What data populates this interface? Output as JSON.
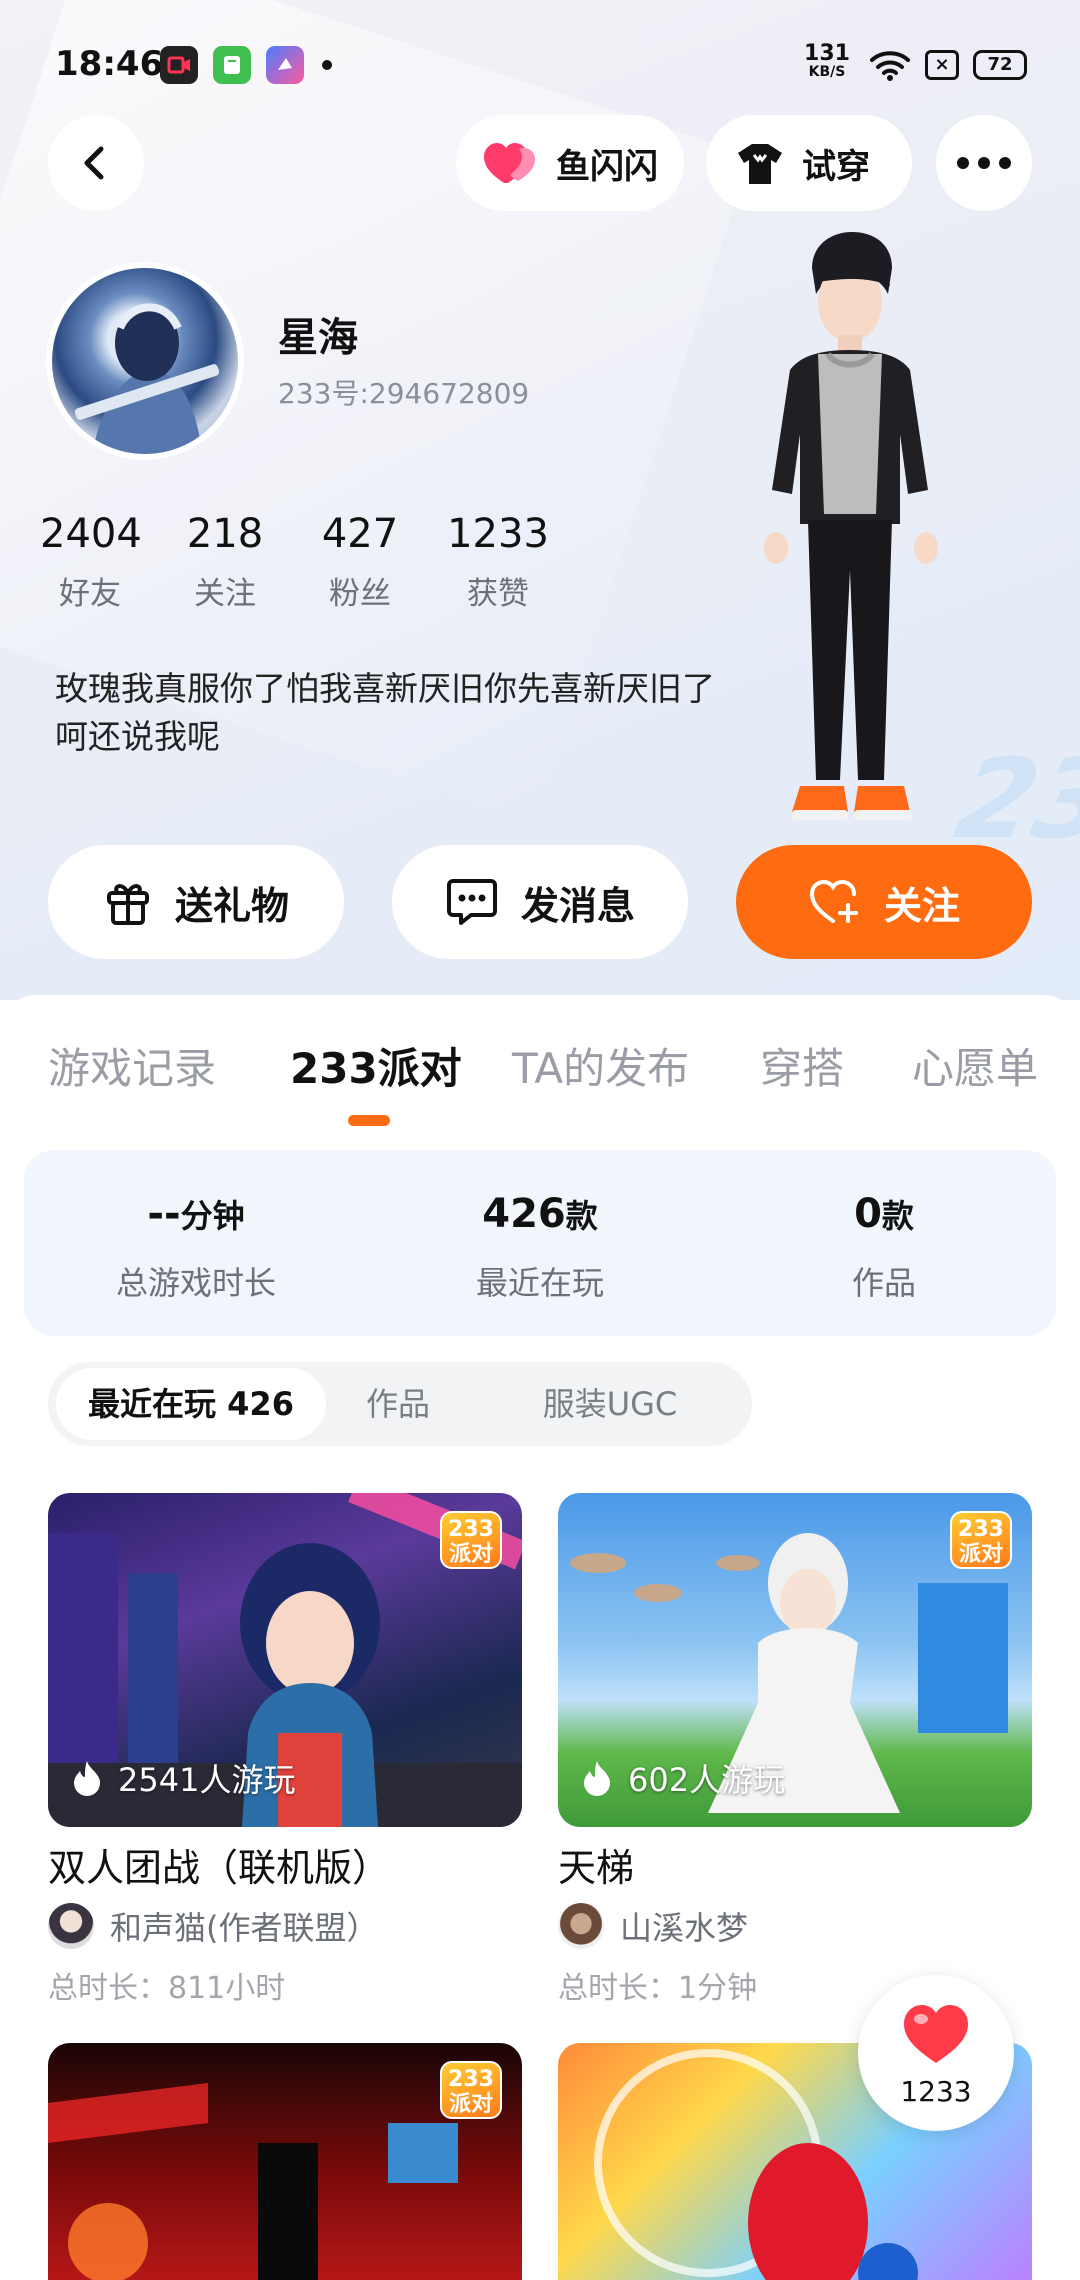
{
  "status_bar": {
    "time": "18:46",
    "net_speed": "131",
    "net_unit": "KB/S",
    "battery": "72"
  },
  "header": {
    "back": "back",
    "flash_label": "鱼闪闪",
    "tryon_label": "试穿",
    "more": "more"
  },
  "profile": {
    "name": "星海",
    "id_text": "233号:294672809",
    "stats": [
      {
        "value": "2404",
        "label": "好友"
      },
      {
        "value": "218",
        "label": "关注"
      },
      {
        "value": "427",
        "label": "粉丝"
      },
      {
        "value": "1233",
        "label": "获赞"
      }
    ],
    "bio": "玫瑰我真服你了怕我喜新厌旧你先喜新厌旧了呵还说我呢"
  },
  "actions": {
    "gift": "送礼物",
    "message": "发消息",
    "follow": "关注"
  },
  "tabs": [
    "游戏记录",
    "233派对",
    "TA的发布",
    "穿搭",
    "心愿单"
  ],
  "active_tab": "233派对",
  "summary": [
    {
      "value": "--",
      "unit": "分钟",
      "caption": "总游戏时长"
    },
    {
      "value": "426",
      "unit": "款",
      "caption": "最近在玩"
    },
    {
      "value": "0",
      "unit": "款",
      "caption": "作品"
    }
  ],
  "segments": [
    "最近在玩 426",
    "作品",
    "服装UGC"
  ],
  "games": [
    {
      "title": "双人团战（联机版）",
      "plays": "2541人游玩",
      "author": "和声猫(作者联盟）",
      "duration": "总时长：811小时",
      "badge_top": "233",
      "badge_bottom": "派对"
    },
    {
      "title": "天梯",
      "plays": "602人游玩",
      "author": "山溪水梦",
      "duration": "总时长：1分钟",
      "badge_top": "233",
      "badge_bottom": "派对"
    }
  ],
  "like_fab": {
    "count": "1233"
  },
  "deco_text": "233",
  "colors": {
    "accent": "#ff6b11",
    "like": "#ff3b4a"
  }
}
